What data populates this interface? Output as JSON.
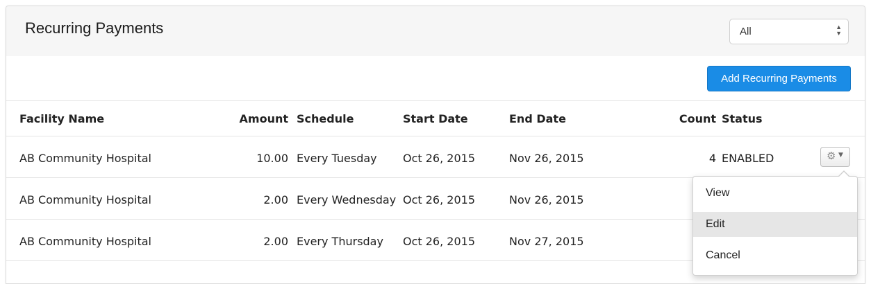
{
  "panel": {
    "title": "Recurring Payments",
    "filter": {
      "selected": "All"
    },
    "add_button": "Add Recurring Payments"
  },
  "table": {
    "headers": {
      "facility": "Facility Name",
      "amount": "Amount",
      "schedule": "Schedule",
      "start": "Start Date",
      "end": "End Date",
      "count": "Count",
      "status": "Status"
    },
    "rows": [
      {
        "facility": "AB Community Hospital",
        "amount": "10.00",
        "schedule": "Every Tuesday",
        "start": "Oct 26, 2015",
        "end": "Nov 26, 2015",
        "count": "4",
        "status": "ENABLED"
      },
      {
        "facility": "AB Community Hospital",
        "amount": "2.00",
        "schedule": "Every Wednesday",
        "start": "Oct 26, 2015",
        "end": "Nov 26, 2015",
        "count": "",
        "status": ""
      },
      {
        "facility": "AB Community Hospital",
        "amount": "2.00",
        "schedule": "Every Thursday",
        "start": "Oct 26, 2015",
        "end": "Nov 27, 2015",
        "count": "",
        "status": ""
      }
    ]
  },
  "action_menu": {
    "icon": "gear-icon",
    "items": [
      "View",
      "Edit",
      "Cancel"
    ],
    "highlighted": "Edit"
  },
  "colors": {
    "primary_button": "#1a8ce6",
    "header_bg": "#f6f6f6",
    "highlight_row": "#e6e6e6"
  }
}
